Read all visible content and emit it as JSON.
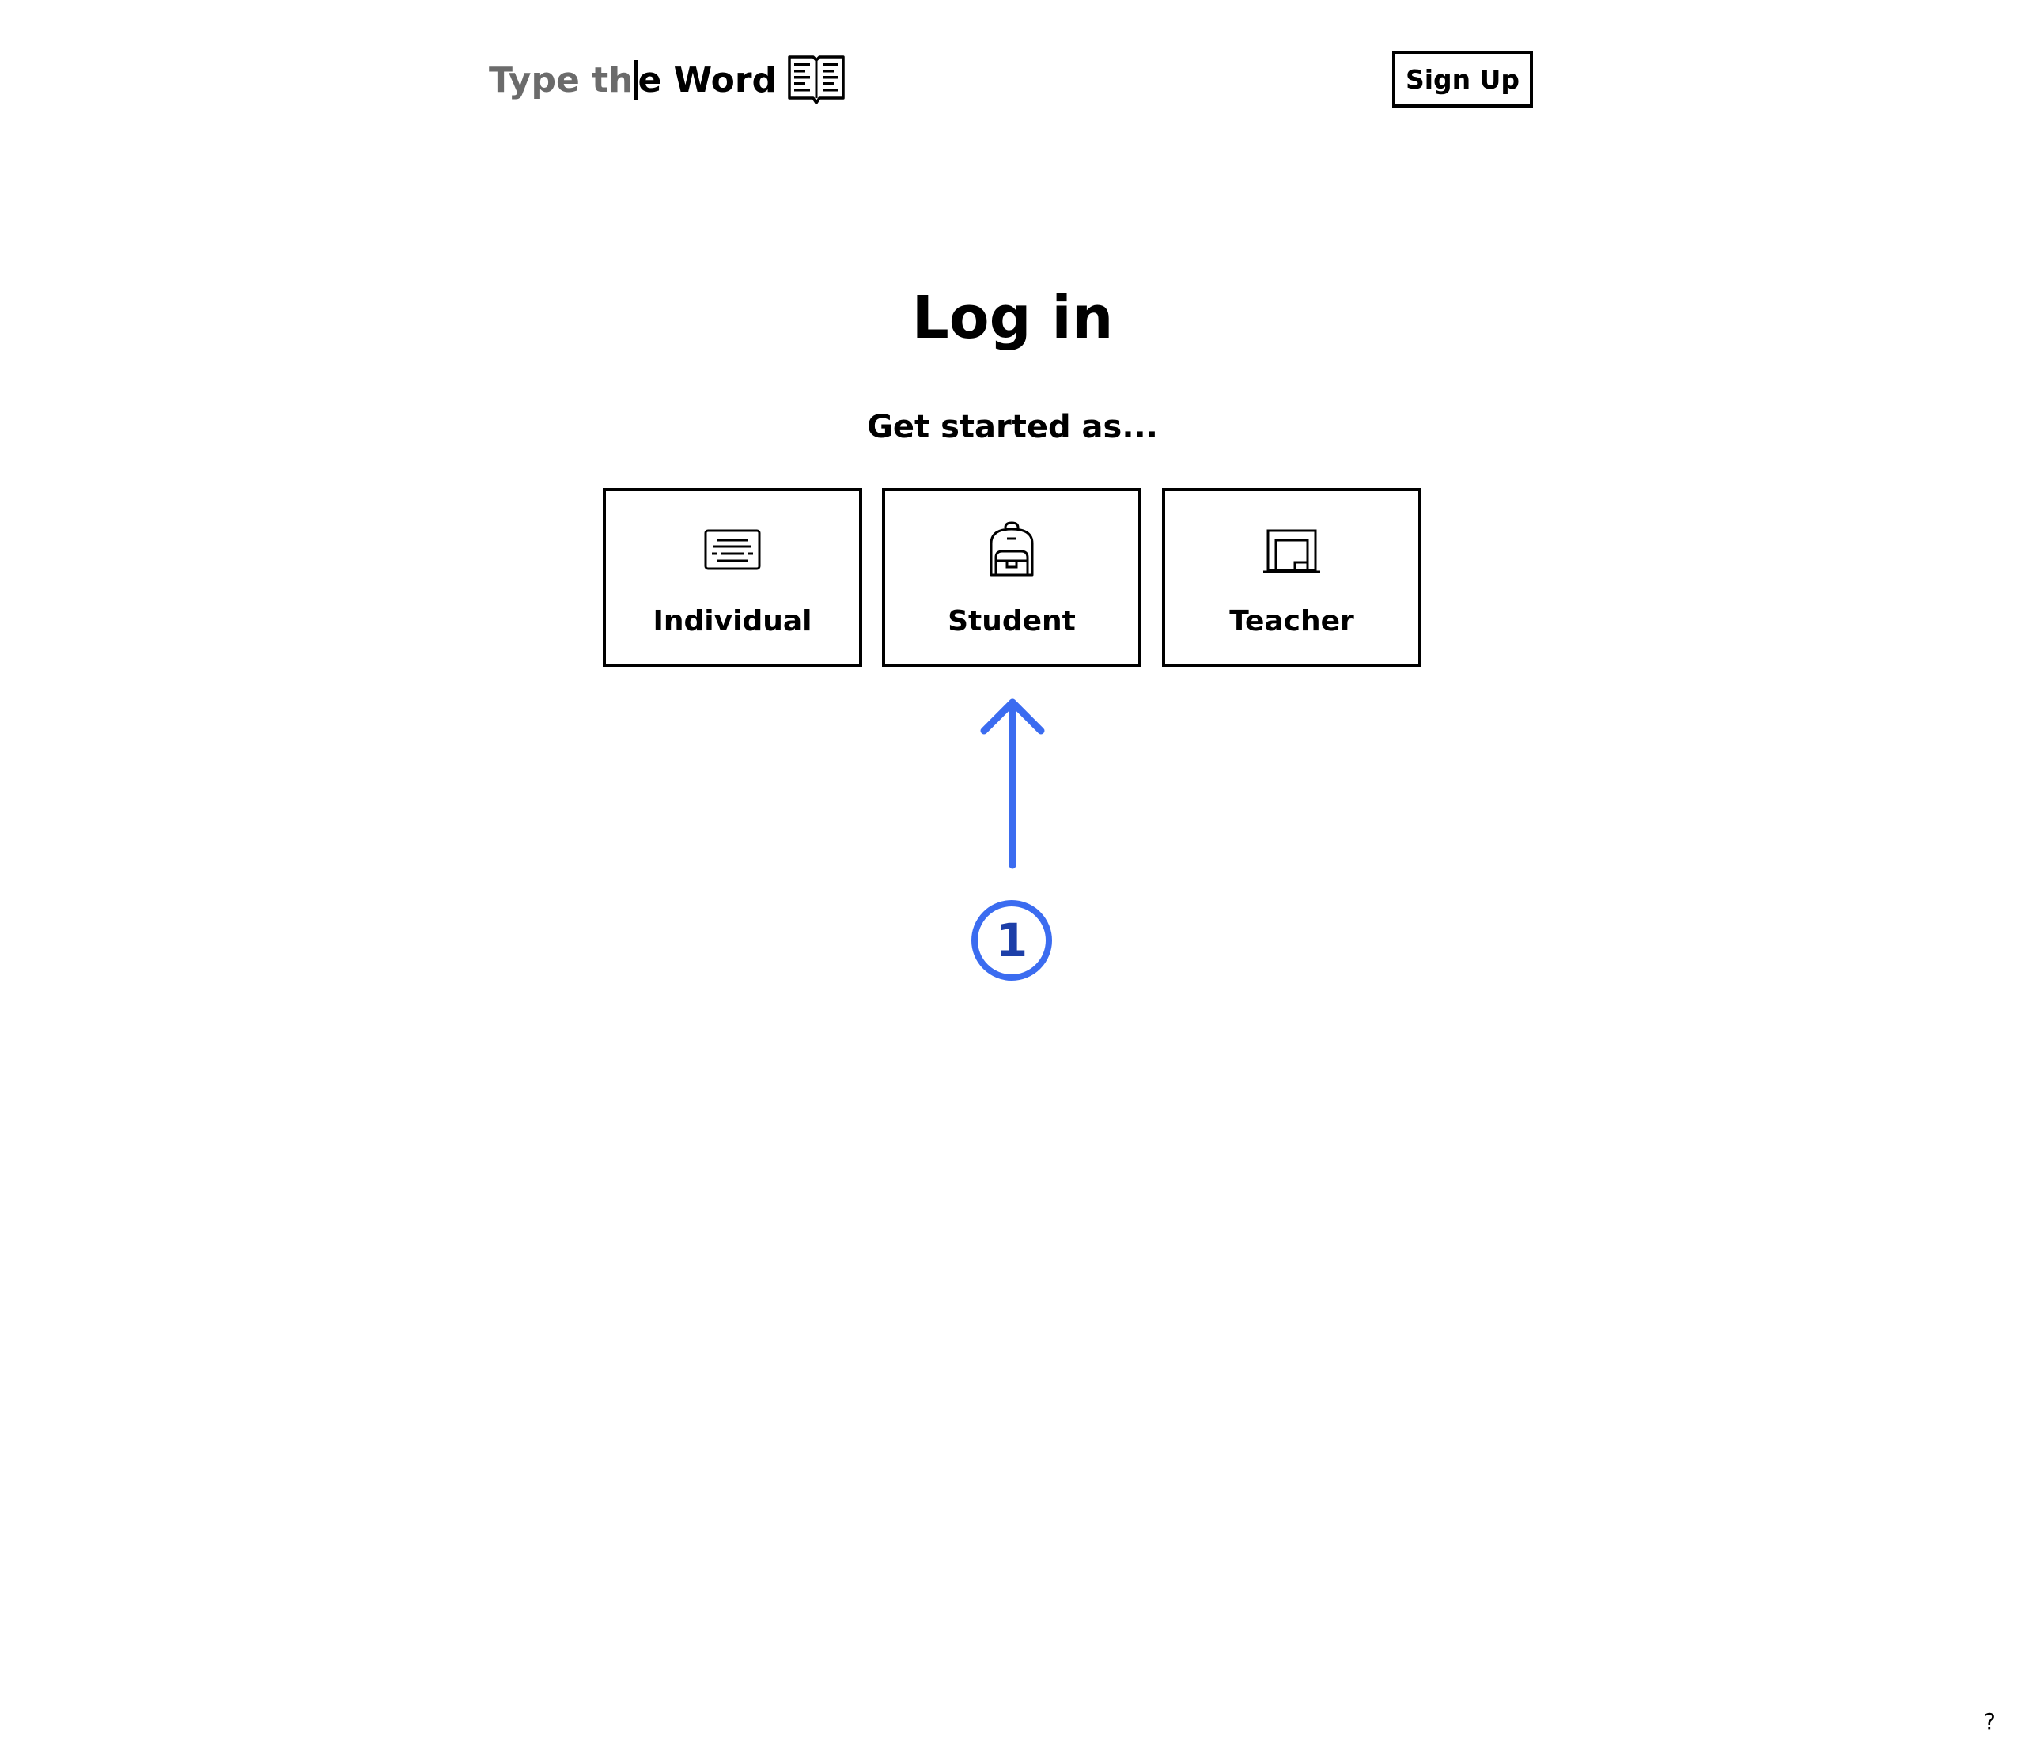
{
  "header": {
    "logo_typed": "Type th",
    "logo_rest": "e Word",
    "logo_icon": "open-book-icon",
    "signup_label": "Sign Up"
  },
  "main": {
    "title": "Log in",
    "subtitle": "Get started as...",
    "roles": [
      {
        "label": "Individual",
        "icon": "keyboard-icon"
      },
      {
        "label": "Student",
        "icon": "backpack-icon"
      },
      {
        "label": "Teacher",
        "icon": "chalkboard-icon"
      }
    ]
  },
  "annotation": {
    "step_number": "1",
    "color": "#3b6cf0",
    "arrow_icon": "arrow-up-icon"
  },
  "footer": {
    "help_label": "?"
  }
}
